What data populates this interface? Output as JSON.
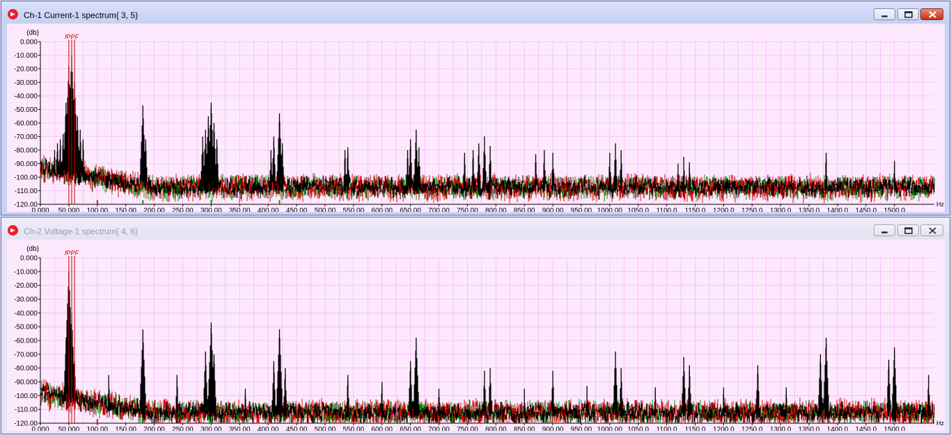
{
  "windows": [
    {
      "title": "Ch-1 Current-1 spectrum{ 3, 5}",
      "title_color": "#000000",
      "icons": [
        "app-icon",
        "minimize-icon",
        "maximize-icon",
        "close-icon"
      ]
    },
    {
      "title": "Ch-2 Voltage-1 spectrum{ 4, 6}",
      "title_color": "#9a9aa6",
      "icons": [
        "app-icon",
        "minimize-icon",
        "maximize-icon",
        "close-icon"
      ]
    }
  ],
  "colors": {
    "background": "#fde9fd",
    "grid": "#f4a6f4",
    "trace_main": "#000000",
    "trace_red": "#e01010",
    "trace_green": "#109010",
    "marker": "#cc0000"
  },
  "chart_data": [
    {
      "type": "line",
      "title": "",
      "ylabel": "(db)",
      "xunit": "Hz",
      "xlim": [
        0,
        1570
      ],
      "ylim": [
        -120,
        0
      ],
      "grid": true,
      "y_ticks": [
        "0.000",
        "-10.000",
        "-20.000",
        "-30.000",
        "-40.000",
        "-50.000",
        "-60.000",
        "-70.000",
        "-80.000",
        "-90.000",
        "-100.00",
        "-110.00",
        "-120.00"
      ],
      "x_ticks": [
        "0.000",
        "50.000",
        "100.00",
        "150.00",
        "200.00",
        "250.00",
        "300.00",
        "350.00",
        "400.00",
        "450.00",
        "500.00",
        "550.00",
        "600.00",
        "650.00",
        "700.00",
        "750.00",
        "800.00",
        "850.00",
        "900.00",
        "950.00",
        "1000.00",
        "1050.0",
        "1100.0",
        "1150.0",
        "1200.0",
        "1250.0",
        "1300.0",
        "1350.0",
        "1400.0",
        "1450.0",
        "1500.0"
      ],
      "markers": {
        "label": "fPPF",
        "x": [
          50,
          55,
          60
        ]
      },
      "noise_floor": -107,
      "peaks": [
        {
          "x": 25,
          "y": -80
        },
        {
          "x": 30,
          "y": -75
        },
        {
          "x": 35,
          "y": -72
        },
        {
          "x": 40,
          "y": -68
        },
        {
          "x": 45,
          "y": -45
        },
        {
          "x": 50,
          "y": -18
        },
        {
          "x": 55,
          "y": -10
        },
        {
          "x": 60,
          "y": -30
        },
        {
          "x": 65,
          "y": -55
        },
        {
          "x": 70,
          "y": -65
        },
        {
          "x": 75,
          "y": -72
        },
        {
          "x": 180,
          "y": -47
        },
        {
          "x": 185,
          "y": -72
        },
        {
          "x": 285,
          "y": -70
        },
        {
          "x": 290,
          "y": -65
        },
        {
          "x": 295,
          "y": -55
        },
        {
          "x": 300,
          "y": -45
        },
        {
          "x": 305,
          "y": -60
        },
        {
          "x": 310,
          "y": -72
        },
        {
          "x": 405,
          "y": -80
        },
        {
          "x": 410,
          "y": -70
        },
        {
          "x": 420,
          "y": -53
        },
        {
          "x": 425,
          "y": -75
        },
        {
          "x": 535,
          "y": -80
        },
        {
          "x": 540,
          "y": -78
        },
        {
          "x": 645,
          "y": -80
        },
        {
          "x": 650,
          "y": -72
        },
        {
          "x": 660,
          "y": -65
        },
        {
          "x": 665,
          "y": -78
        },
        {
          "x": 745,
          "y": -82
        },
        {
          "x": 760,
          "y": -80
        },
        {
          "x": 770,
          "y": -75
        },
        {
          "x": 780,
          "y": -70
        },
        {
          "x": 790,
          "y": -77
        },
        {
          "x": 870,
          "y": -83
        },
        {
          "x": 885,
          "y": -80
        },
        {
          "x": 900,
          "y": -82
        },
        {
          "x": 1000,
          "y": -82
        },
        {
          "x": 1010,
          "y": -75
        },
        {
          "x": 1020,
          "y": -80
        },
        {
          "x": 1120,
          "y": -90
        },
        {
          "x": 1130,
          "y": -85
        },
        {
          "x": 1140,
          "y": -89
        },
        {
          "x": 1380,
          "y": -82
        },
        {
          "x": 1500,
          "y": -88
        }
      ]
    },
    {
      "type": "line",
      "title": "",
      "ylabel": "(db)",
      "xunit": "Hz",
      "xlim": [
        0,
        1570
      ],
      "ylim": [
        -120,
        0
      ],
      "grid": true,
      "y_ticks": [
        "0.000",
        "-10.000",
        "-20.000",
        "-30.000",
        "-40.000",
        "-50.000",
        "-60.000",
        "-70.000",
        "-80.000",
        "-90.000",
        "-100.00",
        "-110.00",
        "-120.00"
      ],
      "x_ticks": [
        "0.000",
        "50.000",
        "100.00",
        "150.00",
        "200.00",
        "250.00",
        "300.00",
        "350.00",
        "400.00",
        "450.00",
        "500.00",
        "550.00",
        "600.00",
        "650.00",
        "700.00",
        "750.00",
        "800.00",
        "850.00",
        "900.00",
        "950.00",
        "1000.00",
        "1050.0",
        "1100.0",
        "1150.0",
        "1200.0",
        "1250.0",
        "1300.0",
        "1350.0",
        "1400.0",
        "1450.0",
        "1500.0"
      ],
      "markers": {
        "label": "fPPF",
        "x": [
          50,
          55,
          60
        ]
      },
      "noise_floor": -112,
      "peaks": [
        {
          "x": 45,
          "y": -60
        },
        {
          "x": 50,
          "y": -10
        },
        {
          "x": 55,
          "y": -40
        },
        {
          "x": 60,
          "y": -75
        },
        {
          "x": 120,
          "y": -85
        },
        {
          "x": 180,
          "y": -52
        },
        {
          "x": 240,
          "y": -85
        },
        {
          "x": 290,
          "y": -68
        },
        {
          "x": 300,
          "y": -47
        },
        {
          "x": 305,
          "y": -70
        },
        {
          "x": 360,
          "y": -95
        },
        {
          "x": 410,
          "y": -75
        },
        {
          "x": 420,
          "y": -52
        },
        {
          "x": 430,
          "y": -80
        },
        {
          "x": 540,
          "y": -85
        },
        {
          "x": 600,
          "y": -90
        },
        {
          "x": 650,
          "y": -75
        },
        {
          "x": 660,
          "y": -58
        },
        {
          "x": 700,
          "y": -95
        },
        {
          "x": 780,
          "y": -82
        },
        {
          "x": 790,
          "y": -80
        },
        {
          "x": 850,
          "y": -95
        },
        {
          "x": 900,
          "y": -82
        },
        {
          "x": 960,
          "y": -93
        },
        {
          "x": 1010,
          "y": -68
        },
        {
          "x": 1020,
          "y": -80
        },
        {
          "x": 1080,
          "y": -94
        },
        {
          "x": 1130,
          "y": -72
        },
        {
          "x": 1140,
          "y": -78
        },
        {
          "x": 1200,
          "y": -94
        },
        {
          "x": 1260,
          "y": -78
        },
        {
          "x": 1310,
          "y": -94
        },
        {
          "x": 1370,
          "y": -70
        },
        {
          "x": 1380,
          "y": -58
        },
        {
          "x": 1490,
          "y": -74
        },
        {
          "x": 1500,
          "y": -65
        },
        {
          "x": 1560,
          "y": -85
        }
      ]
    }
  ]
}
